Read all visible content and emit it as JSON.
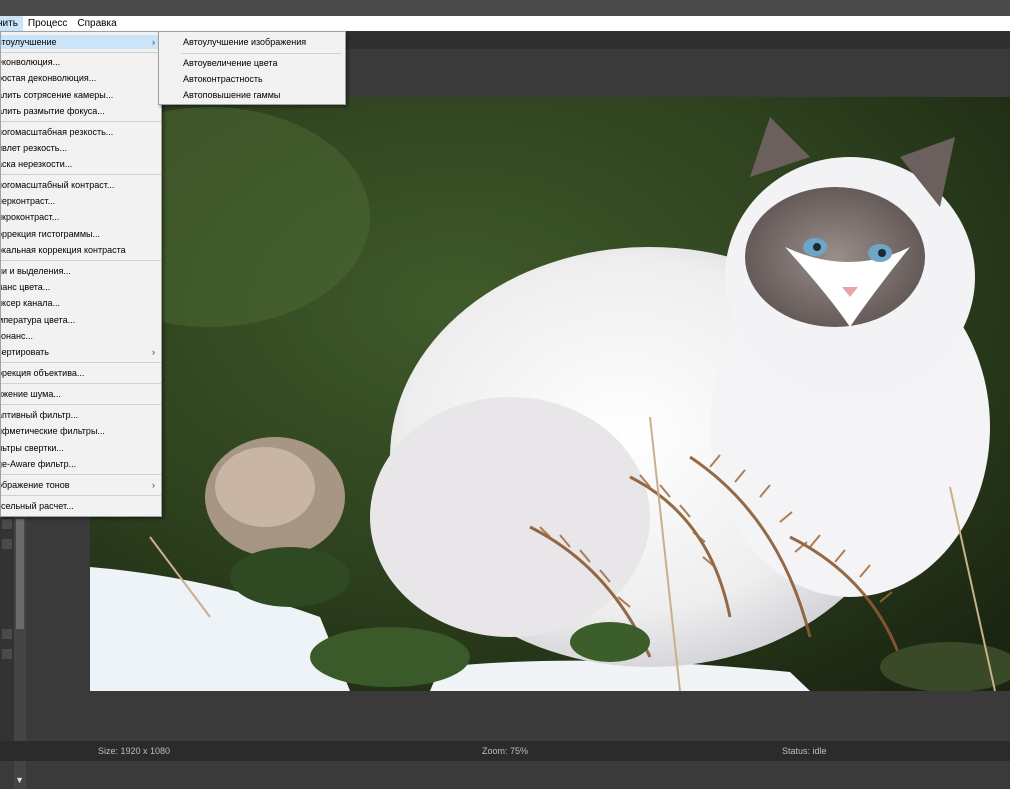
{
  "menubar": {
    "items": [
      {
        "label": "нить",
        "active": true
      },
      {
        "label": "Процесс",
        "active": false
      },
      {
        "label": "Справка",
        "active": false
      }
    ]
  },
  "dropdown": {
    "items": [
      {
        "label": "втоулучшение",
        "submenu": true,
        "highlighted": true
      },
      {
        "label": "еконволюция...",
        "submenu": false
      },
      {
        "label": "ростая деконволюция...",
        "submenu": false
      },
      {
        "label": "алить сотрясение камеры...",
        "submenu": false
      },
      {
        "label": "алить размытие фокуса...",
        "submenu": false
      },
      {
        "label": "ногомасштабная резкость...",
        "submenu": false
      },
      {
        "label": "йвлет резкость...",
        "submenu": false
      },
      {
        "label": "аска нерезкости...",
        "submenu": false
      },
      {
        "label": "ногомасштабный контраст...",
        "submenu": false
      },
      {
        "label": "перконтраст...",
        "submenu": false
      },
      {
        "label": "икроконтраст...",
        "submenu": false
      },
      {
        "label": "оррекция гистограммы...",
        "submenu": false
      },
      {
        "label": "окальная коррекция контраста",
        "submenu": false
      },
      {
        "label": "ни и выделения...",
        "submenu": false
      },
      {
        "label": "ланс цвета...",
        "submenu": false
      },
      {
        "label": "иксер канала...",
        "submenu": false
      },
      {
        "label": "мпература цвета...",
        "submenu": false
      },
      {
        "label": "зонанс...",
        "submenu": false
      },
      {
        "label": "вертировать",
        "submenu": true
      },
      {
        "label": "ррекция объектива...",
        "submenu": false
      },
      {
        "label": "ижение шума...",
        "submenu": false
      },
      {
        "label": "аптивный фильтр...",
        "submenu": false
      },
      {
        "label": "ифметические фильтры...",
        "submenu": false
      },
      {
        "label": "льтры свертки...",
        "submenu": false
      },
      {
        "label": "ge-Aware фильтр...",
        "submenu": false
      },
      {
        "label": "ображение тонов",
        "submenu": true
      },
      {
        "label": "ксельный расчет...",
        "submenu": false
      }
    ]
  },
  "submenu": {
    "items": [
      {
        "label": "Автоулучшение изображения"
      },
      {
        "label": "Автоувеличение цвета"
      },
      {
        "label": "Автоконтрастность"
      },
      {
        "label": "Автоповышение гаммы"
      }
    ]
  },
  "icons": {
    "submenu_arrow": "chevron-right-icon",
    "scroll_down": "chevron-down-icon"
  },
  "statusbar": {
    "size": "Size: 1920 x 1080",
    "zoom": "Zoom: 75%",
    "status": "Status: idle"
  }
}
